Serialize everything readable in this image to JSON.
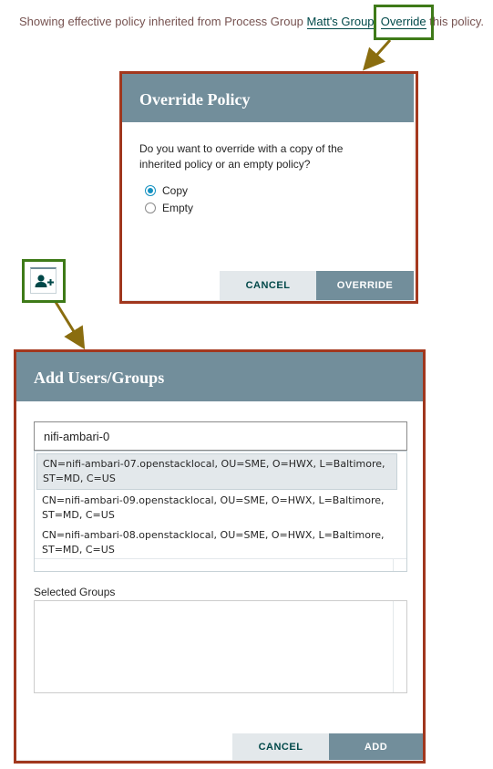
{
  "inherited_notice": {
    "prefix": "Showing effective policy inherited from Process Group ",
    "group_link": "Matt's Group",
    "separator": ". ",
    "override_link": "Override",
    "suffix": " this policy."
  },
  "override_dialog": {
    "title": "Override Policy",
    "question": "Do you want to override with a copy of the inherited policy or an empty policy?",
    "options": [
      {
        "label": "Copy",
        "checked": true
      },
      {
        "label": "Empty",
        "checked": false
      }
    ],
    "cancel_label": "CANCEL",
    "confirm_label": "OVERRIDE"
  },
  "add_user_icon": "add-user-icon",
  "add_users_dialog": {
    "title": "Add Users/Groups",
    "search_value": "nifi-ambari-0",
    "suggestions": [
      "CN=nifi-ambari-07.openstacklocal, OU=SME, O=HWX, L=Baltimore, ST=MD, C=US",
      "CN=nifi-ambari-09.openstacklocal, OU=SME, O=HWX, L=Baltimore, ST=MD, C=US",
      "CN=nifi-ambari-08.openstacklocal, OU=SME, O=HWX, L=Baltimore, ST=MD, C=US"
    ],
    "selected_groups_label": "Selected Groups",
    "cancel_label": "CANCEL",
    "confirm_label": "ADD"
  },
  "colors": {
    "callout_green": "#3e7a18",
    "callout_red": "#a5391f",
    "arrow": "#8a6d0f",
    "header": "#728e9b",
    "link": "#004849"
  }
}
